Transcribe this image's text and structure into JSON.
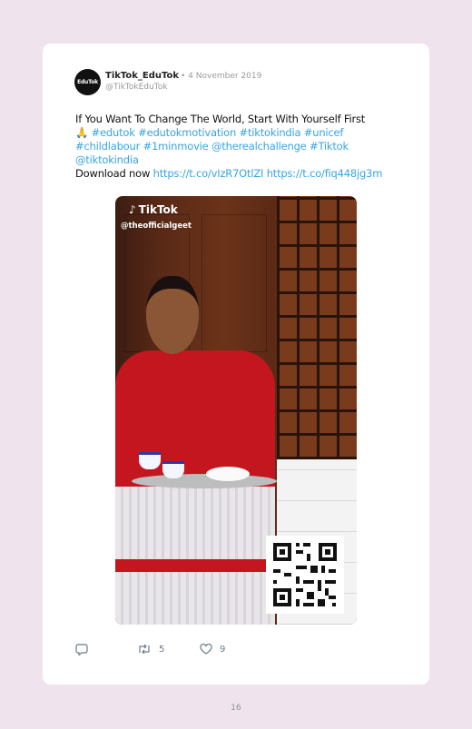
{
  "tweet": {
    "avatar_text": "EduTok",
    "display_name": "TikTok_EduTok",
    "date": "• 4 November 2019",
    "handle": "@TikTokEduTok",
    "lines": [
      {
        "plain": "If You Want To Change The World, Start With Yourself First"
      },
      {
        "link": "🙏 #edutok #edutokmotivation #tiktokindia #unicef"
      },
      {
        "link": "#childlabour #1minmovie @therealchallenge #Tiktok"
      },
      {
        "link": "@tiktokindia"
      }
    ],
    "download_label": "Download now",
    "url_1": "https://t.co/vIzR7OtlZI",
    "url_2": "https://t.co/fiq448jg3m"
  },
  "media": {
    "brand": "TikTok",
    "creator_handle": "@theofficialgeet",
    "qr_icon": "qr-code-icon"
  },
  "actions": {
    "reply_icon": "reply-icon",
    "retweet_icon": "retweet-icon",
    "retweet_count": "5",
    "like_icon": "heart-icon",
    "like_count": "9"
  },
  "page_number": "16",
  "colors": {
    "background": "#efe4ee",
    "link": "#39a3e3",
    "muted": "#9a9a9a"
  }
}
